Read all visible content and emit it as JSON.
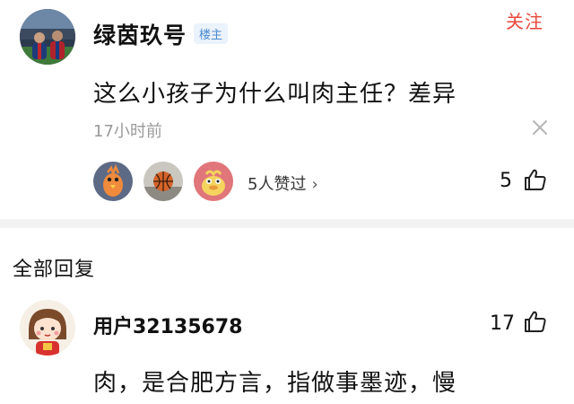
{
  "comment": {
    "username": "绿茵玖号",
    "badge": "楼主",
    "follow_label": "关注",
    "text": "这么小孩子为什么叫肉主任？差异",
    "time": "17小时前",
    "likers_text": "5人赞过",
    "likers_chevron": "›",
    "like_count": "5",
    "avatar_icon": "soccer-players-photo",
    "liker_icons": [
      "bird-avatar",
      "basketball-avatar",
      "cartoon-bird-avatar"
    ]
  },
  "section": {
    "title": "全部回复"
  },
  "reply": {
    "username": "用户32135678",
    "like_count": "17",
    "text": "肉，是合肥方言，指做事墨迹，慢",
    "avatar_icon": "cartoon-girl-avatar"
  },
  "colors": {
    "follow": "#e8473b",
    "badge_text": "#4a8bd0",
    "badge_bg": "#eaf2fb",
    "muted_text": "#9a9a9a",
    "divider": "#f2f2f2"
  }
}
